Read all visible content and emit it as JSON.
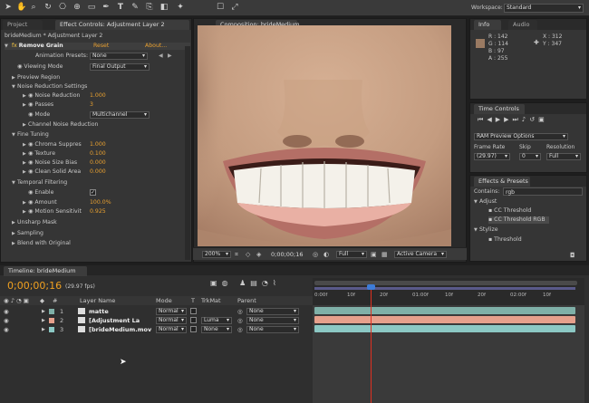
{
  "toolbar": {
    "workspace_label": "Workspace:",
    "workspace_value": "Standard",
    "tool_icons": [
      "selection",
      "hand",
      "zoom",
      "rotate",
      "camera",
      "pan-behind",
      "pen",
      "type",
      "brush",
      "clone",
      "eraser",
      "puppet"
    ]
  },
  "left_panel": {
    "tab_project": "Project",
    "tab_effect_controls": "Effect Controls: Adjustment Layer 2",
    "breadcrumb": "brideMedium * Adjustment Layer 2",
    "effect_name": "Remove Grain",
    "reset": "Reset",
    "about": "About...",
    "rows": {
      "animation_presets_label": "Animation Presets:",
      "animation_presets_value": "None",
      "viewing_mode_label": "Viewing Mode",
      "viewing_mode_value": "Final Output",
      "preview_region": "Preview Region",
      "noise_reduction_settings": "Noise Reduction Settings",
      "noise_reduction_label": "Noise Reduction",
      "noise_reduction_value": "1.000",
      "passes_label": "Passes",
      "passes_value": "3",
      "mode_label": "Mode",
      "mode_value": "Multichannel",
      "channel_noise_reduction": "Channel Noise Reduction",
      "fine_tuning": "Fine Tuning",
      "chroma_label": "Chroma Suppres",
      "chroma_value": "1.000",
      "texture_label": "Texture",
      "texture_value": "0.100",
      "noise_size_label": "Noise Size Bias",
      "noise_size_value": "0.000",
      "clean_solid_label": "Clean Solid Area",
      "clean_solid_value": "0.000",
      "temporal_filtering": "Temporal Filtering",
      "enable_label": "Enable",
      "amount_label": "Amount",
      "amount_value": "100.0%",
      "motion_label": "Motion Sensitivit",
      "motion_value": "0.925",
      "unsharp_mask": "Unsharp Mask",
      "sampling": "Sampling",
      "blend_with_original": "Blend with Original"
    }
  },
  "composition": {
    "tab": "Composition: brideMedium",
    "zoom": "200%",
    "timecode": "0;00;00;16",
    "resolution": "Full",
    "camera": "Active Camera"
  },
  "info_panel": {
    "tab_info": "Info",
    "tab_audio": "Audio",
    "r": "R : 142",
    "g": "G : 114",
    "b": "B : 97",
    "a": "A : 255",
    "x": "X : 312",
    "y": "Y : 347",
    "swatch_color": "#9a7a62"
  },
  "time_controls": {
    "tab": "Time Controls",
    "options": "RAM Preview Options",
    "frame_rate_label": "Frame Rate",
    "skip_label": "Skip",
    "resolution_label": "Resolution",
    "frame_rate_value": "(29.97)",
    "skip_value": "0",
    "resolution_value": "Full"
  },
  "effects_presets": {
    "tab": "Effects & Presets",
    "contains_label": "Contains:",
    "contains_value": "rgb",
    "adjust": "Adjust",
    "cc_threshold": "CC Threshold",
    "cc_threshold_rgb": "CC Threshold RGB",
    "stylize": "Stylize",
    "threshold": "Threshold"
  },
  "timeline": {
    "tab": "Timeline: brideMedium",
    "timecode": "0;00;00;16",
    "fps": "(29.97 fps)",
    "headers": {
      "layer_name": "Layer Name",
      "mode": "Mode",
      "t": "T",
      "trkmat": "TrkMat",
      "parent": "Parent"
    },
    "layers": [
      {
        "num": "1",
        "name": "matte",
        "mode": "Normal",
        "trkmat": "",
        "parent": "None",
        "color": "#7fb0a8"
      },
      {
        "num": "2",
        "name": "[Adjustment La",
        "mode": "Normal",
        "trkmat": "Luma",
        "parent": "None",
        "color": "#e6a08c"
      },
      {
        "num": "3",
        "name": "[brideMedium.mov",
        "mode": "Normal",
        "trkmat": "None",
        "parent": "None",
        "color": "#8cc8c4"
      }
    ],
    "ruler": [
      "0:00f",
      "10f",
      "20f",
      "01:00f",
      "10f",
      "20f",
      "02:00f",
      "10f"
    ]
  }
}
